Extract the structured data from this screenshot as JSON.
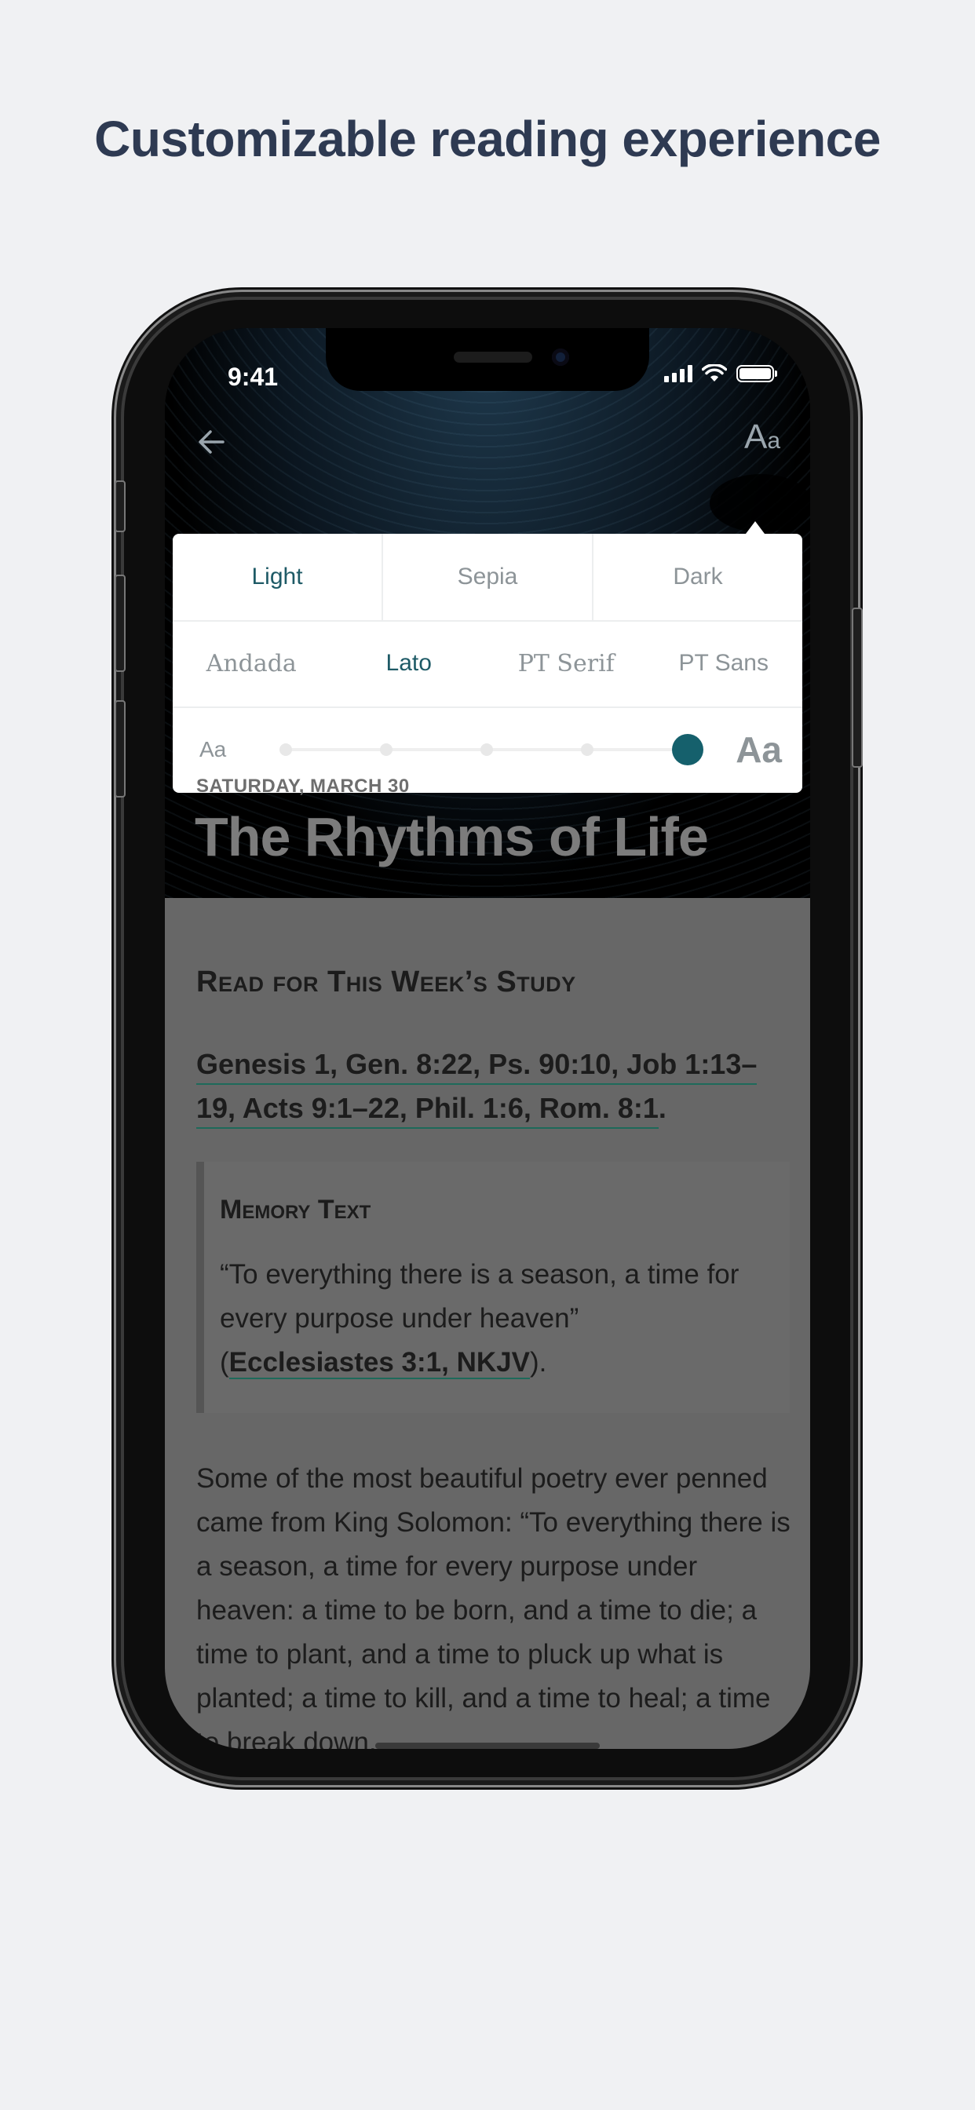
{
  "headline": "Customizable reading experience",
  "status_bar": {
    "time": "9:41"
  },
  "nav": {
    "font_button": "A",
    "font_button_small": "a"
  },
  "reading_settings": {
    "themes": [
      {
        "label": "Light",
        "active": true
      },
      {
        "label": "Sepia",
        "active": false
      },
      {
        "label": "Dark",
        "active": false
      }
    ],
    "fonts": [
      {
        "label": "Andada",
        "active": false
      },
      {
        "label": "Lato",
        "active": true
      },
      {
        "label": "PT Serif",
        "active": false
      },
      {
        "label": "PT Sans",
        "active": false
      }
    ],
    "size_small_label": "Aa",
    "size_large_label": "Aa",
    "size_level": 5,
    "size_levels": 5,
    "accent_color": "#15606c"
  },
  "lesson": {
    "date": "SATURDAY, MARCH 30",
    "title": "The Rhythms of Life",
    "section_heading": "Read for This Week’s Study",
    "refs_line1": "Genesis 1, Gen. 8:22, Ps. 90:10, Job 1:13–",
    "refs_line2": "19, Acts 9:1–22, Phil. 1:6, Rom. 8:1",
    "refs_end": ".",
    "memory_heading": "Memory Text",
    "memory_quote": "“To everything there is a season, a time for every purpose under heaven”",
    "memory_open": "(",
    "memory_ref": "Ecclesiastes 3:1, NKJV",
    "memory_close": ").",
    "body": "Some of the most beautiful poetry ever penned came from King Solomon: “To everything there is a season, a time for every purpose under heaven: a time to be born, and a time to die; a time to plant, and a time to pluck up what is planted; a time to kill, and a time to heal; a time to break down,"
  }
}
